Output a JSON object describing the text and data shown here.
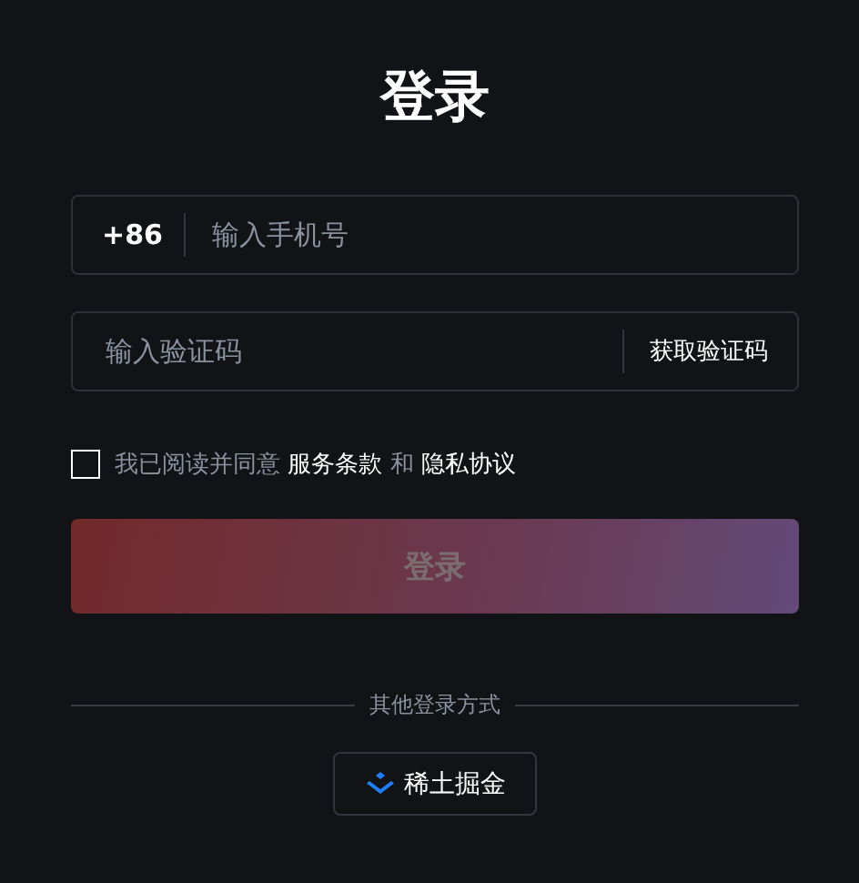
{
  "title": "登录",
  "phone_field": {
    "country_code": "+86",
    "placeholder": "输入手机号"
  },
  "code_field": {
    "placeholder": "输入验证码",
    "action": "获取验证码"
  },
  "agreement": {
    "checked": false,
    "parts": [
      {
        "kind": "text",
        "text": "我已阅读并同意 "
      },
      {
        "kind": "link",
        "text": "服务条款"
      },
      {
        "kind": "text",
        "text": " 和 "
      },
      {
        "kind": "link",
        "text": "隐私协议"
      }
    ]
  },
  "login_button": {
    "label": "登录",
    "disabled": true
  },
  "other_methods": {
    "label": "其他登录方式",
    "buttons": [
      {
        "label": "稀土掘金"
      }
    ]
  }
}
